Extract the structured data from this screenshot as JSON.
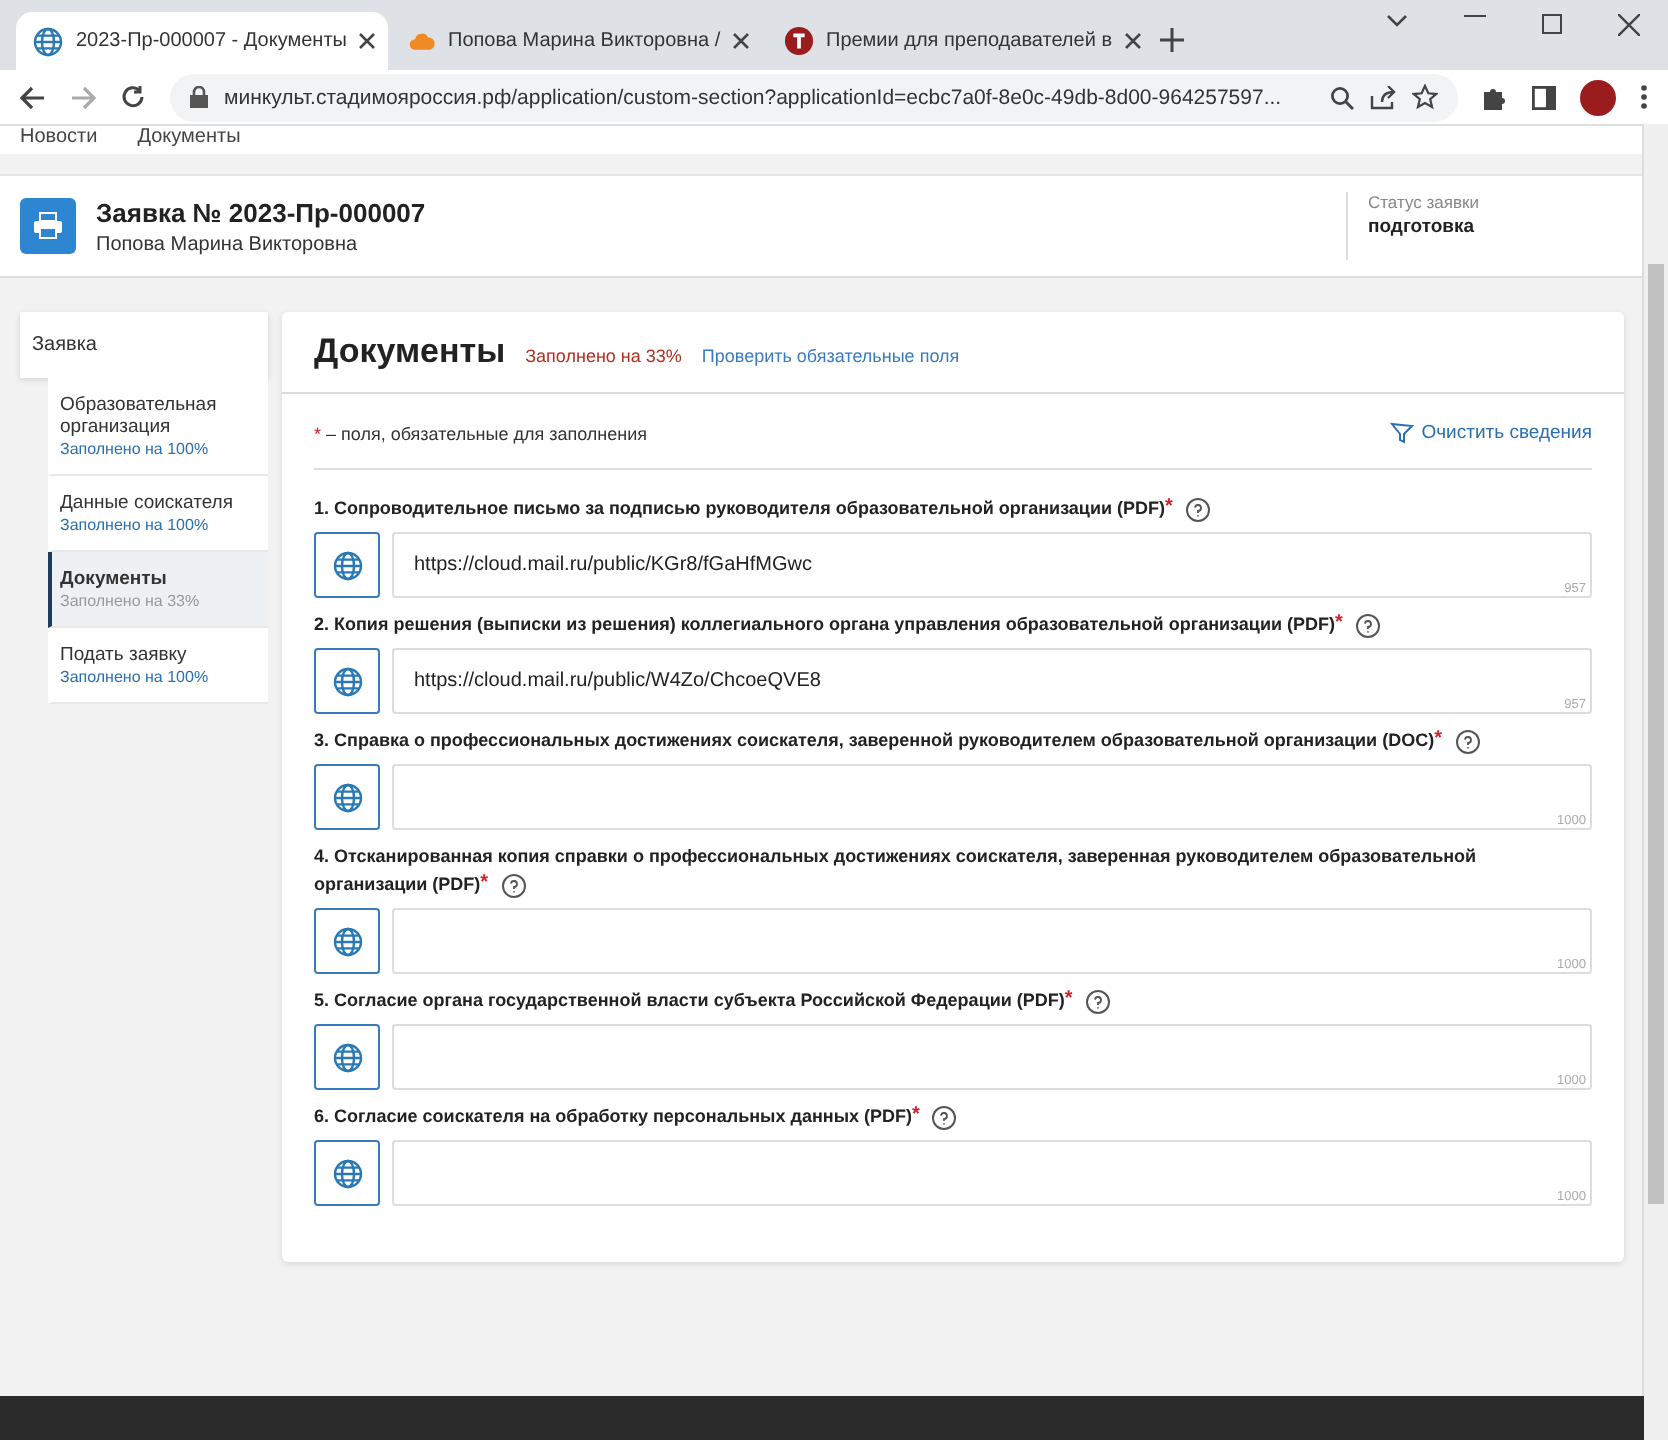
{
  "browser": {
    "tabs": [
      {
        "title": "2023-Пр-000007 - Документы",
        "selected": true
      },
      {
        "title": "Попова Марина Викторовна /",
        "selected": false
      },
      {
        "title": "Премии для преподавателей в",
        "selected": false
      }
    ],
    "address": "минкульт.стадимояроссия.рф/application/custom-section?applicationId=ecbc7a0f-8e0c-49db-8d00-964257597..."
  },
  "breadcrumbs": [
    "Новости",
    "Документы"
  ],
  "header": {
    "title": "Заявка № 2023-Пр-000007",
    "subtitle": "Попова Марина Викторовна",
    "status_label": "Статус заявки",
    "status_value": "подготовка"
  },
  "sidebar": {
    "title": "Заявка",
    "items": [
      {
        "label": "Образовательная организация",
        "progress": "Заполнено на 100%",
        "selected": false
      },
      {
        "label": "Данные соискателя",
        "progress": "Заполнено на 100%",
        "selected": false
      },
      {
        "label": "Документы",
        "progress": "Заполнено на 33%",
        "selected": true
      },
      {
        "label": "Подать заявку",
        "progress": "Заполнено на 100%",
        "selected": false
      }
    ]
  },
  "main": {
    "title": "Документы",
    "progress": "Заполнено на 33%",
    "check_link": "Проверить обязательные поля",
    "required_mark": "*",
    "required_note": "– поля, обязательные для заполнения",
    "clear_button": "Очистить сведения",
    "fields": [
      {
        "label": "1. Сопроводительное письмо за подписью руководителя образовательной организации (PDF)",
        "required": true,
        "value": "https://cloud.mail.ru/public/KGr8/fGaHfMGwc",
        "counter": "957"
      },
      {
        "label": "2. Копия решения (выписки из решения) коллегиального органа управления образовательной организации (PDF)",
        "required": true,
        "value": "https://cloud.mail.ru/public/W4Zo/ChcoeQVE8",
        "counter": "957"
      },
      {
        "label": "3. Справка о профессиональных достижениях соискателя, заверенной руководителем образовательной организации (DOC)",
        "required": true,
        "counter": "1000"
      },
      {
        "label": "4. Отсканированная копия справки о профессиональных достижениях соискателя, заверенная руководителем образовательной организации (PDF)",
        "required": true,
        "counter": "1000"
      },
      {
        "label": "5. Согласие органа государственной власти субъекта Российской Федерации (PDF)",
        "required": true,
        "counter": "1000"
      },
      {
        "label": "6. Согласие соискателя на обработку персональных данных (PDF)",
        "required": true,
        "counter": "1000"
      }
    ]
  }
}
